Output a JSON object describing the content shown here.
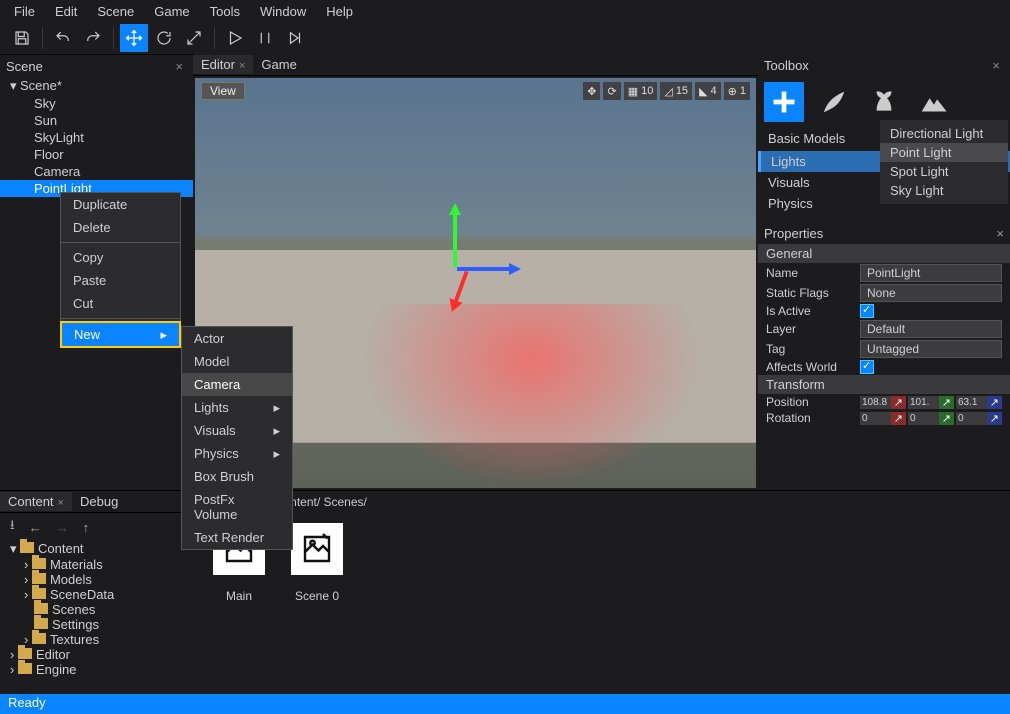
{
  "menubar": {
    "items": [
      "File",
      "Edit",
      "Scene",
      "Game",
      "Tools",
      "Window",
      "Help"
    ]
  },
  "toolbar_icons": [
    "save",
    "undo",
    "redo",
    "move",
    "rotate",
    "scale",
    "play",
    "pause",
    "step"
  ],
  "scene_panel": {
    "title": "Scene",
    "root": "Scene*",
    "children": [
      "Sky",
      "Sun",
      "SkyLight",
      "Floor",
      "Camera",
      "PointLight"
    ],
    "selected": "PointLight"
  },
  "context_menu_1": {
    "items": [
      "Duplicate",
      "Delete",
      "Copy",
      "Paste",
      "Cut",
      "New"
    ],
    "highlighted": "New"
  },
  "context_menu_2": {
    "items": [
      "Actor",
      "Model",
      "Camera",
      "Lights",
      "Visuals",
      "Physics",
      "Box Brush",
      "PostFx Volume",
      "Text Render"
    ],
    "highlighted": "Camera",
    "has_submenu": [
      "Lights",
      "Visuals",
      "Physics"
    ]
  },
  "editor_tabs": {
    "tabs": [
      "Editor",
      "Game"
    ],
    "active": "Editor"
  },
  "viewport": {
    "button_view": "View",
    "toolbar": {
      "grid": "10",
      "angle": "15",
      "snap": "4",
      "cam": "1"
    }
  },
  "toolbox": {
    "title": "Toolbox",
    "section_title": "Basic Models",
    "categories": [
      "Lights",
      "Visuals",
      "Physics"
    ],
    "active_cat": "Lights",
    "light_menu": [
      "Directional Light",
      "Point Light",
      "Spot Light",
      "Sky Light"
    ],
    "light_menu_sel": "Point Light"
  },
  "properties": {
    "title": "Properties",
    "groups": {
      "general": {
        "header": "General",
        "name_label": "Name",
        "name_val": "PointLight",
        "static_label": "Static Flags",
        "static_val": "None",
        "active_label": "Is Active",
        "active_val": true,
        "layer_label": "Layer",
        "layer_val": "Default",
        "tag_label": "Tag",
        "tag_val": "Untagged",
        "affects_label": "Affects World",
        "affects_val": true
      },
      "transform": {
        "header": "Transform",
        "pos_label": "Position",
        "pos": [
          "108.8",
          "101.",
          "63.1"
        ],
        "rot_label": "Rotation",
        "rot": [
          "0",
          "0",
          "0"
        ]
      }
    }
  },
  "content": {
    "tabs": [
      "Content",
      "Debug"
    ],
    "active_tab": "Content",
    "breadcrumb": "…tures Tour/    Content/    Scenes/",
    "folders": [
      "Content",
      "Materials",
      "Models",
      "SceneData",
      "Scenes",
      "Settings",
      "Textures",
      "Editor",
      "Engine"
    ],
    "selected_folder": "Scenes",
    "thumbs": [
      "Main",
      "Scene 0"
    ]
  },
  "status": {
    "text": "Ready"
  }
}
